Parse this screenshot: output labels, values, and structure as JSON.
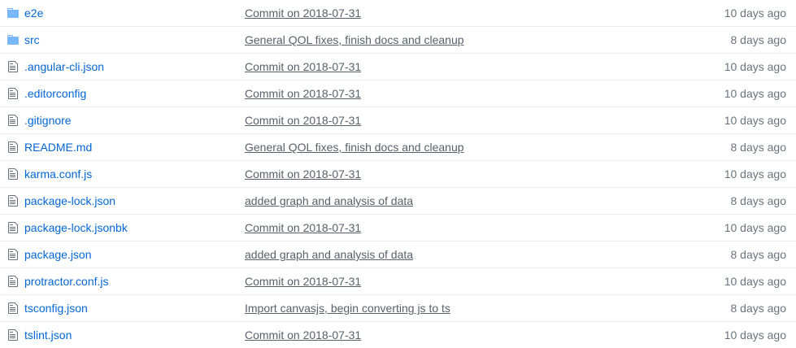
{
  "colors": {
    "link": "#0366d6",
    "message": "#586069",
    "age": "#6a737d",
    "folder_icon": "#79b8ff",
    "file_icon": "#6a737d",
    "divider": "#eaecef"
  },
  "files": [
    {
      "icon": "folder-icon",
      "name": "e2e",
      "message": "Commit on 2018-07-31",
      "age": "10 days ago"
    },
    {
      "icon": "folder-icon",
      "name": "src",
      "message": "General QOL fixes, finish docs and cleanup",
      "age": "8 days ago"
    },
    {
      "icon": "file-icon",
      "name": ".angular-cli.json",
      "message": "Commit on 2018-07-31",
      "age": "10 days ago"
    },
    {
      "icon": "file-icon",
      "name": ".editorconfig",
      "message": "Commit on 2018-07-31",
      "age": "10 days ago"
    },
    {
      "icon": "file-icon",
      "name": ".gitignore",
      "message": "Commit on 2018-07-31",
      "age": "10 days ago"
    },
    {
      "icon": "file-icon",
      "name": "README.md",
      "message": "General QOL fixes, finish docs and cleanup",
      "age": "8 days ago"
    },
    {
      "icon": "file-icon",
      "name": "karma.conf.js",
      "message": "Commit on 2018-07-31",
      "age": "10 days ago"
    },
    {
      "icon": "file-icon",
      "name": "package-lock.json",
      "message": "added graph and analysis of data",
      "age": "8 days ago"
    },
    {
      "icon": "file-icon",
      "name": "package-lock.jsonbk",
      "message": "Commit on 2018-07-31",
      "age": "10 days ago"
    },
    {
      "icon": "file-icon",
      "name": "package.json",
      "message": "added graph and analysis of data",
      "age": "8 days ago"
    },
    {
      "icon": "file-icon",
      "name": "protractor.conf.js",
      "message": "Commit on 2018-07-31",
      "age": "10 days ago"
    },
    {
      "icon": "file-icon",
      "name": "tsconfig.json",
      "message": "Import canvasjs, begin converting js to ts",
      "age": "8 days ago"
    },
    {
      "icon": "file-icon",
      "name": "tslint.json",
      "message": "Commit on 2018-07-31",
      "age": "10 days ago"
    }
  ]
}
